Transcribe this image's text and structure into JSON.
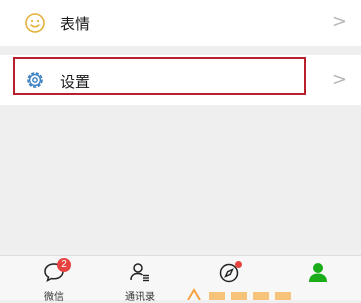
{
  "rows": {
    "emoji": {
      "label": "表情",
      "icon": "smile-icon",
      "chevron": ">"
    },
    "settings": {
      "label": "设置",
      "icon": "gear-icon",
      "chevron": ">"
    }
  },
  "tabbar": {
    "items": [
      {
        "label": "微信",
        "icon": "chat-bubble-icon",
        "badge": "2"
      },
      {
        "label": "通讯录",
        "icon": "contacts-icon"
      },
      {
        "label": "",
        "icon": "compass-icon",
        "dot": true
      },
      {
        "label": "",
        "icon": "person-icon",
        "active": true
      }
    ]
  },
  "colors": {
    "highlight": "#b8212c",
    "accent": "#1aad19",
    "badge": "#e64340",
    "background": "#efefef"
  }
}
